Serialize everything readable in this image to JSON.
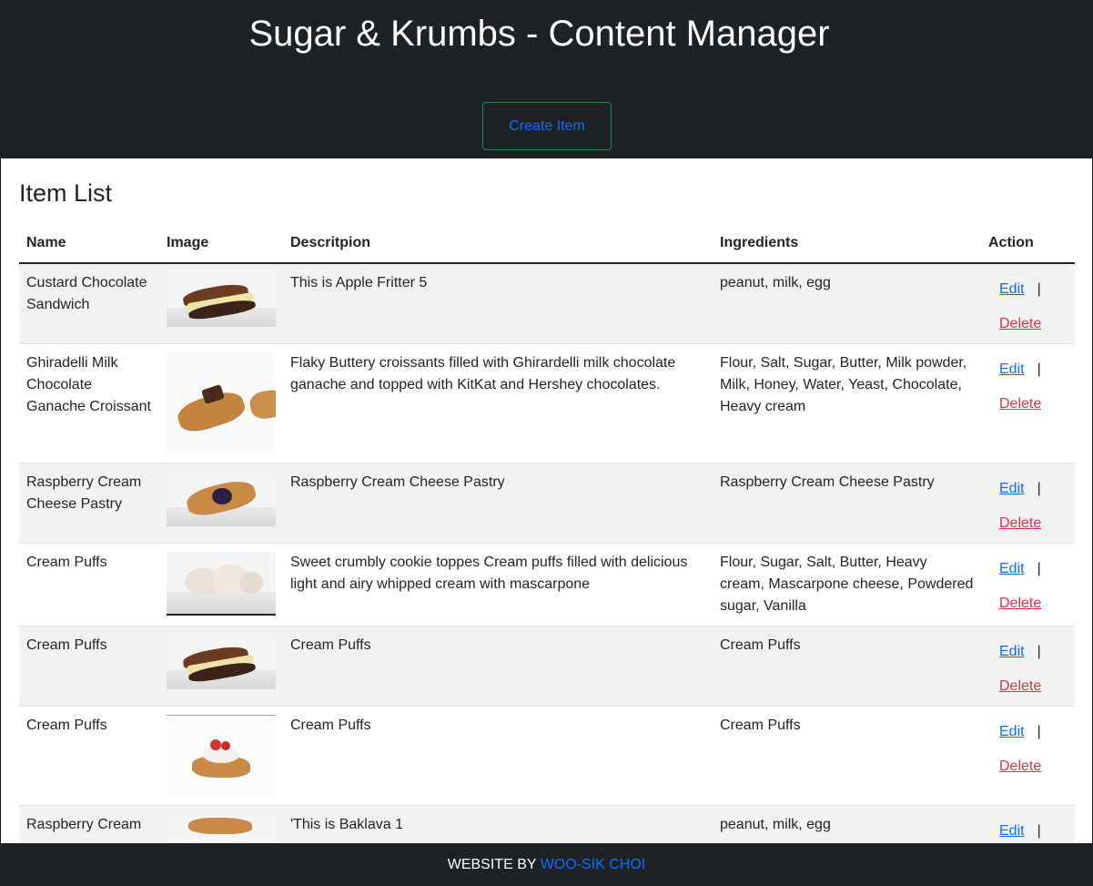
{
  "header": {
    "title": "Sugar & Krumbs - Content Manager",
    "create_button": "Create Item"
  },
  "main": {
    "title": "Item List",
    "columns": [
      "Name",
      "Image",
      "Descritpion",
      "Ingredients",
      "Action"
    ],
    "edit_label": "Edit",
    "delete_label": "Delete",
    "separator": "|",
    "rows": [
      {
        "name": "Custard Chocolate Sandwich",
        "image_icon": "sandwich-pastry-icon",
        "description": "This is Apple Fritter 5",
        "ingredients": "peanut, milk, egg"
      },
      {
        "name": "Ghiradelli Milk Chocolate Ganache Croissant",
        "image_icon": "croissant-icon",
        "description": "Flaky Buttery croissants filled with Ghirardelli milk chocolate ganache and topped with KitKat and Hershey chocolates.",
        "ingredients": "Flour, Salt, Sugar, Butter, Milk powder, Milk, Honey, Water, Yeast, Chocolate, Heavy cream"
      },
      {
        "name": "Raspberry Cream Cheese Pastry",
        "image_icon": "danish-pastry-icon",
        "description": "Raspberry Cream Cheese Pastry",
        "ingredients": "Raspberry Cream Cheese Pastry"
      },
      {
        "name": "Cream Puffs",
        "image_icon": "cream-puff-icon",
        "description": "Sweet crumbly cookie toppes Cream puffs filled with delicious light and airy whipped cream with mascarpone",
        "ingredients": "Flour, Sugar, Salt, Butter, Heavy cream, Mascarpone cheese, Powdered sugar, Vanilla"
      },
      {
        "name": "Cream Puffs",
        "image_icon": "sandwich-pastry-icon",
        "description": "Cream Puffs",
        "ingredients": "Cream Puffs"
      },
      {
        "name": "Cream Puffs",
        "image_icon": "strawberry-croissant-icon",
        "description": "Cream Puffs",
        "ingredients": "Cream Puffs"
      },
      {
        "name": "Raspberry Cream",
        "image_icon": "pastry-icon",
        "description": "'This is Baklava 1",
        "ingredients": "peanut, milk, egg"
      }
    ]
  },
  "footer": {
    "prefix": "WEBSITE BY ",
    "author": "WOO-SIK CHOI"
  },
  "colors": {
    "header_bg": "#1e2225",
    "link_blue": "#0d6efd",
    "delete_red": "#dc3545",
    "button_border": "#198754",
    "stripe": "#f2f2f2"
  }
}
